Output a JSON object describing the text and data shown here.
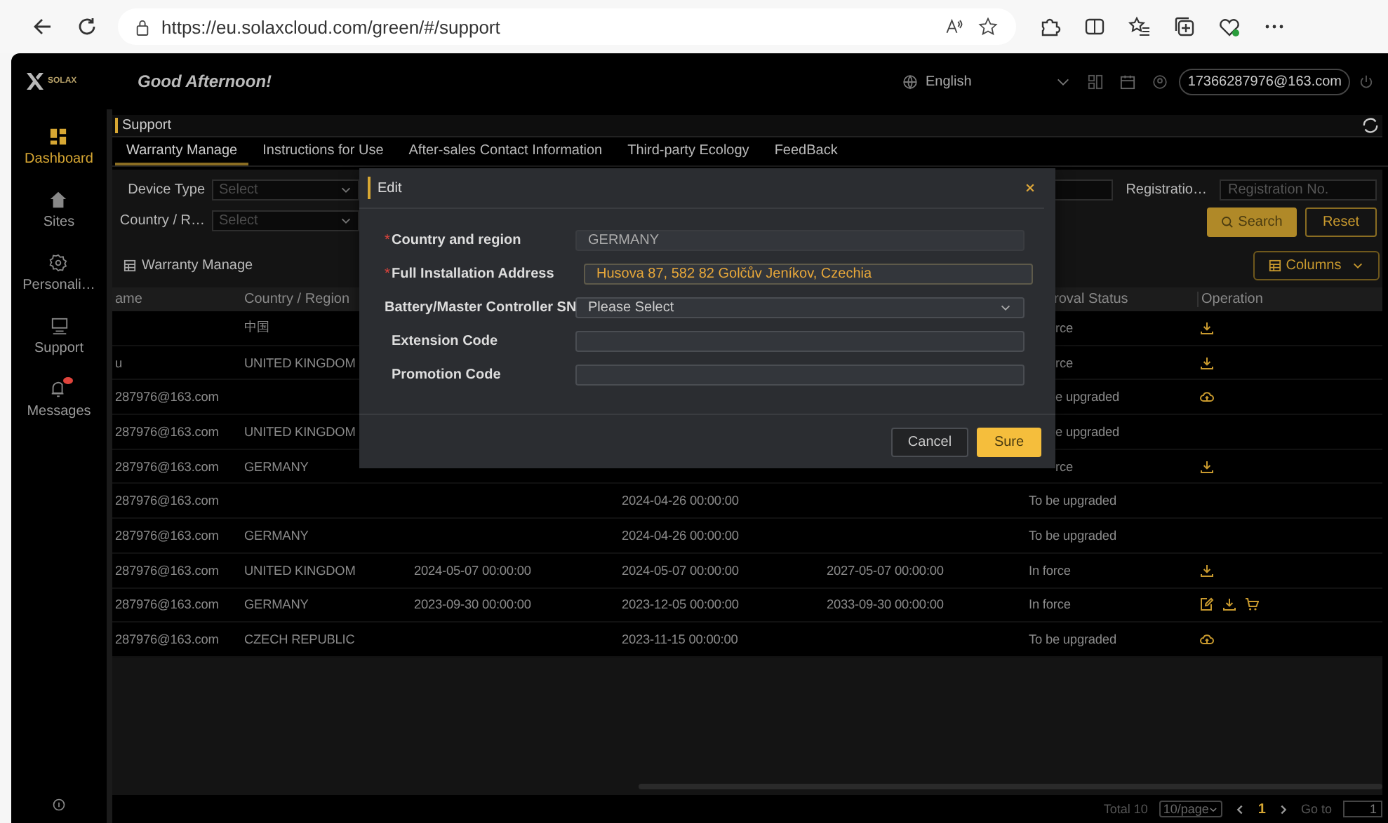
{
  "browser": {
    "url": "https://eu.solaxcloud.com/green/#/support"
  },
  "header": {
    "logo": "SOLAX",
    "greeting": "Good Afternoon!",
    "language": "English",
    "account": "17366287976@163.com"
  },
  "sidebar": [
    {
      "label": "Dashboard",
      "kind": "dashboard",
      "selected": true,
      "badge": false
    },
    {
      "label": "Sites",
      "kind": "home",
      "selected": false,
      "badge": false
    },
    {
      "label": "Personali…",
      "kind": "gear",
      "selected": false,
      "badge": false
    },
    {
      "label": "Support",
      "kind": "monitor",
      "selected": false,
      "badge": false
    },
    {
      "label": "Messages",
      "kind": "bell",
      "selected": false,
      "badge": true
    }
  ],
  "breadcrumb": "Support",
  "tabs": [
    {
      "label": "Warranty Manage",
      "selected": true
    },
    {
      "label": "Instructions for Use",
      "selected": false
    },
    {
      "label": "After-sales Contact Information",
      "selected": false
    },
    {
      "label": "Third-party Ecology",
      "selected": false
    },
    {
      "label": "FeedBack",
      "selected": false
    }
  ],
  "filters": [
    {
      "label": "Device Type",
      "placeholder": "Select"
    },
    {
      "label": "Country / R…",
      "placeholder": "Select"
    }
  ],
  "registration": {
    "label": "Registratio…",
    "placeholder": "Registration No."
  },
  "search_button": "Search",
  "reset_button": "Reset",
  "section_title": "Warranty Manage",
  "columns_button": "Columns",
  "table": {
    "columns": [
      "ame",
      "Country / Region",
      "roval Status",
      "Operation"
    ],
    "rows": [
      {
        "country": "中国",
        "status": "rce",
        "operations": [
          {
            "kind": "download"
          }
        ]
      },
      {
        "name": "u",
        "country": "UNITED KINGDOM",
        "status": "rce",
        "operations": [
          {
            "kind": "download"
          }
        ]
      },
      {
        "name": "287976@163.com",
        "status": "e upgraded",
        "operations": [
          {
            "kind": "cloud-upload"
          }
        ]
      },
      {
        "name": "287976@163.com",
        "country": "UNITED KINGDOM",
        "status": "e upgraded"
      },
      {
        "name": "287976@163.com",
        "country": "GERMANY",
        "status": "rce",
        "operations": [
          {
            "kind": "download"
          }
        ]
      },
      {
        "name": "287976@163.com",
        "column_4": "2024-04-26 00:00:00",
        "status": "To be upgraded"
      },
      {
        "name": "287976@163.com",
        "country": "GERMANY",
        "column_4": "2024-04-26 00:00:00",
        "status": "To be upgraded"
      },
      {
        "name": "287976@163.com",
        "country": "UNITED KINGDOM",
        "column_3": "2024-05-07 00:00:00",
        "column_4": "2024-05-07 00:00:00",
        "column_5": "2027-05-07 00:00:00",
        "status": "In force",
        "operations": [
          {
            "kind": "download"
          }
        ]
      },
      {
        "name": "287976@163.com",
        "country": "GERMANY",
        "column_3": "2023-09-30 00:00:00",
        "column_4": "2023-12-05 00:00:00",
        "column_5": "2033-09-30 00:00:00",
        "status": "In force",
        "operations": [
          {
            "kind": "edit"
          },
          {
            "kind": "download"
          },
          {
            "kind": "cart"
          }
        ]
      },
      {
        "name": "287976@163.com",
        "country": "CZECH REPUBLIC",
        "column_4": "2023-11-15 00:00:00",
        "status": "To be upgraded",
        "operations": [
          {
            "kind": "cloud-upload"
          }
        ]
      }
    ]
  },
  "pagination": {
    "total": "Total 10",
    "page_size": "10/page",
    "page": "1",
    "goto_label": "Go to",
    "goto_value": "1"
  },
  "dialog": {
    "title": "Edit",
    "fields": [
      {
        "required_mark": "*",
        "label": "Country and region",
        "kind": "text",
        "disabled": true,
        "highlighted": false,
        "value": "GERMANY"
      },
      {
        "required_mark": "*",
        "label": "Full Installation Address",
        "kind": "text",
        "disabled": false,
        "highlighted": true,
        "value": "Husova 87, 582 82 Golčův Jeníkov, Czechia"
      },
      {
        "label": "Battery/Master Controller SN",
        "kind": "select",
        "disabled": false,
        "highlighted": false,
        "placeholder": "Please Select"
      },
      {
        "label": "Extension Code",
        "kind": "text",
        "disabled": false,
        "highlighted": false
      },
      {
        "label": "Promotion Code",
        "kind": "text",
        "disabled": false,
        "highlighted": false
      }
    ],
    "cancel": "Cancel",
    "confirm": "Sure"
  }
}
